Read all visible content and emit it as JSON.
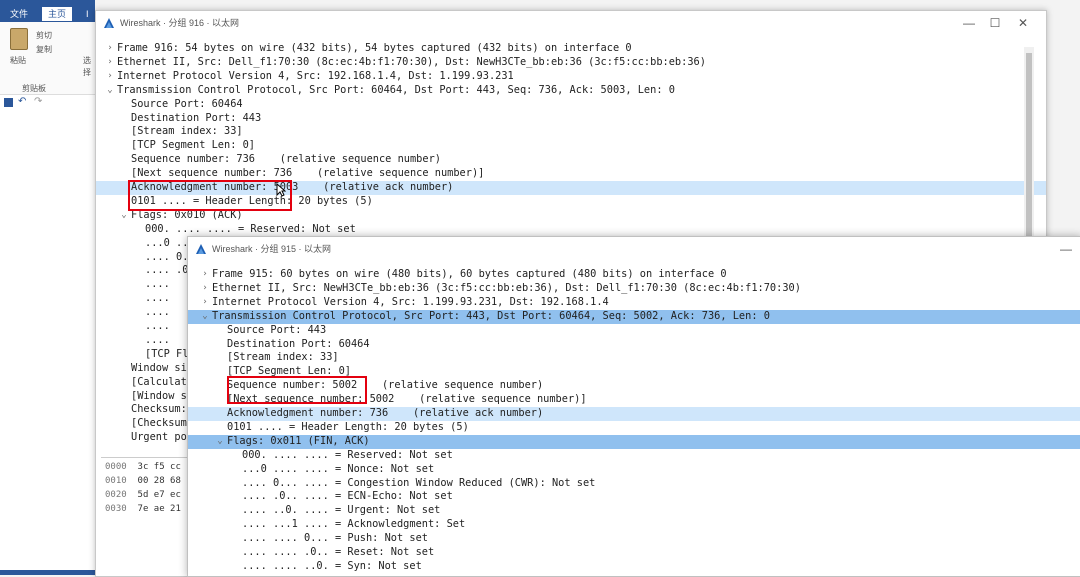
{
  "bg_app": {
    "tabs": [
      "文件",
      "主页",
      "I"
    ],
    "clipboard_labels": [
      "粘贴",
      "剪切",
      "复制",
      "剪贴板"
    ],
    "partial_text": [
      "选",
      "择"
    ]
  },
  "window1": {
    "title": "Wireshark · 分组 916 · 以太网",
    "controls": [
      "—",
      "☐",
      "✕"
    ],
    "tree": [
      {
        "arrow": ">",
        "indent": 0,
        "text": "Frame 916: 54 bytes on wire (432 bits), 54 bytes captured (432 bits) on interface 0"
      },
      {
        "arrow": ">",
        "indent": 0,
        "text": "Ethernet II, Src: Dell_f1:70:30 (8c:ec:4b:f1:70:30), Dst: NewH3CTe_bb:eb:36 (3c:f5:cc:bb:eb:36)"
      },
      {
        "arrow": ">",
        "indent": 0,
        "text": "Internet Protocol Version 4, Src: 192.168.1.4, Dst: 1.199.93.231"
      },
      {
        "arrow": "v",
        "indent": 0,
        "text": "Transmission Control Protocol, Src Port: 60464, Dst Port: 443, Seq: 736, Ack: 5003, Len: 0"
      },
      {
        "arrow": "",
        "indent": 1,
        "text": "Source Port: 60464"
      },
      {
        "arrow": "",
        "indent": 1,
        "text": "Destination Port: 443"
      },
      {
        "arrow": "",
        "indent": 1,
        "text": "[Stream index: 33]"
      },
      {
        "arrow": "",
        "indent": 1,
        "text": "[TCP Segment Len: 0]"
      },
      {
        "arrow": "",
        "indent": 1,
        "text": "Sequence number: 736    (relative sequence number)"
      },
      {
        "arrow": "",
        "indent": 1,
        "text": "[Next sequence number: 736    (relative sequence number)]"
      },
      {
        "arrow": "",
        "indent": 1,
        "text": "Acknowledgment number: 5003    (relative ack number)",
        "hl": "light"
      },
      {
        "arrow": "",
        "indent": 1,
        "text": "0101 .... = Header Length: 20 bytes (5)"
      },
      {
        "arrow": "v",
        "indent": 1,
        "text": "Flags: 0x010 (ACK)"
      },
      {
        "arrow": "",
        "indent": 2,
        "text": "000. .... .... = Reserved: Not set"
      },
      {
        "arrow": "",
        "indent": 2,
        "text": "...0 ...."
      },
      {
        "arrow": "",
        "indent": 2,
        "text": ".... 0."
      },
      {
        "arrow": "",
        "indent": 2,
        "text": ".... .0"
      },
      {
        "arrow": "",
        "indent": 2,
        "text": "...."
      },
      {
        "arrow": "",
        "indent": 2,
        "text": "...."
      },
      {
        "arrow": "",
        "indent": 2,
        "text": "...."
      },
      {
        "arrow": "",
        "indent": 2,
        "text": "...."
      },
      {
        "arrow": "",
        "indent": 2,
        "text": "...."
      },
      {
        "arrow": "",
        "indent": 2,
        "text": "[TCP Fl"
      },
      {
        "arrow": "",
        "indent": 1,
        "text": "Window siz"
      },
      {
        "arrow": "",
        "indent": 1,
        "text": "[Calculate"
      },
      {
        "arrow": "",
        "indent": 1,
        "text": "[Window si"
      },
      {
        "arrow": "",
        "indent": 1,
        "text": "Checksum:"
      },
      {
        "arrow": "",
        "indent": 1,
        "text": "[Checksum"
      },
      {
        "arrow": "",
        "indent": 1,
        "text": "Urgent poi"
      }
    ],
    "hex_rows": [
      {
        "offset": "0000",
        "bytes": "3c f5 cc"
      },
      {
        "offset": "0010",
        "bytes": "00 28 68"
      },
      {
        "offset": "0020",
        "bytes": "5d e7 ec"
      },
      {
        "offset": "0030",
        "bytes": "7e ae 21"
      }
    ]
  },
  "window2": {
    "title": "Wireshark · 分组 915 · 以太网",
    "controls": [
      "—"
    ],
    "tree": [
      {
        "arrow": ">",
        "indent": 0,
        "text": "Frame 915: 60 bytes on wire (480 bits), 60 bytes captured (480 bits) on interface 0"
      },
      {
        "arrow": ">",
        "indent": 0,
        "text": "Ethernet II, Src: NewH3CTe_bb:eb:36 (3c:f5:cc:bb:eb:36), Dst: Dell_f1:70:30 (8c:ec:4b:f1:70:30)"
      },
      {
        "arrow": ">",
        "indent": 0,
        "text": "Internet Protocol Version 4, Src: 1.199.93.231, Dst: 192.168.1.4"
      },
      {
        "arrow": "v",
        "indent": 0,
        "text": "Transmission Control Protocol, Src Port: 443, Dst Port: 60464, Seq: 5002, Ack: 736, Len: 0",
        "hl": "sel"
      },
      {
        "arrow": "",
        "indent": 1,
        "text": "Source Port: 443"
      },
      {
        "arrow": "",
        "indent": 1,
        "text": "Destination Port: 60464"
      },
      {
        "arrow": "",
        "indent": 1,
        "text": "[Stream index: 33]"
      },
      {
        "arrow": "",
        "indent": 1,
        "text": "[TCP Segment Len: 0]"
      },
      {
        "arrow": "",
        "indent": 1,
        "text": "Sequence number: 5002    (relative sequence number)"
      },
      {
        "arrow": "",
        "indent": 1,
        "text": "[Next sequence number: 5002    (relative sequence number)]"
      },
      {
        "arrow": "",
        "indent": 1,
        "text": "Acknowledgment number: 736    (relative ack number)",
        "hl": "light"
      },
      {
        "arrow": "",
        "indent": 1,
        "text": "0101 .... = Header Length: 20 bytes (5)"
      },
      {
        "arrow": "v",
        "indent": 1,
        "text": "Flags: 0x011 (FIN, ACK)",
        "hl": "sel"
      },
      {
        "arrow": "",
        "indent": 2,
        "text": "000. .... .... = Reserved: Not set"
      },
      {
        "arrow": "",
        "indent": 2,
        "text": "...0 .... .... = Nonce: Not set"
      },
      {
        "arrow": "",
        "indent": 2,
        "text": ".... 0... .... = Congestion Window Reduced (CWR): Not set"
      },
      {
        "arrow": "",
        "indent": 2,
        "text": ".... .0.. .... = ECN-Echo: Not set"
      },
      {
        "arrow": "",
        "indent": 2,
        "text": ".... ..0. .... = Urgent: Not set"
      },
      {
        "arrow": "",
        "indent": 2,
        "text": ".... ...1 .... = Acknowledgment: Set"
      },
      {
        "arrow": "",
        "indent": 2,
        "text": ".... .... 0... = Push: Not set"
      },
      {
        "arrow": "",
        "indent": 2,
        "text": ".... .... .0.. = Reset: Not set"
      },
      {
        "arrow": "",
        "indent": 2,
        "text": ".... .... ..0. = Syn: Not set"
      }
    ]
  },
  "colors": {
    "highlight_light": "#cfe6fb",
    "highlight_selected": "#90c0ee",
    "annotation_red": "#e3000f",
    "ribbon_blue": "#2b579a"
  }
}
